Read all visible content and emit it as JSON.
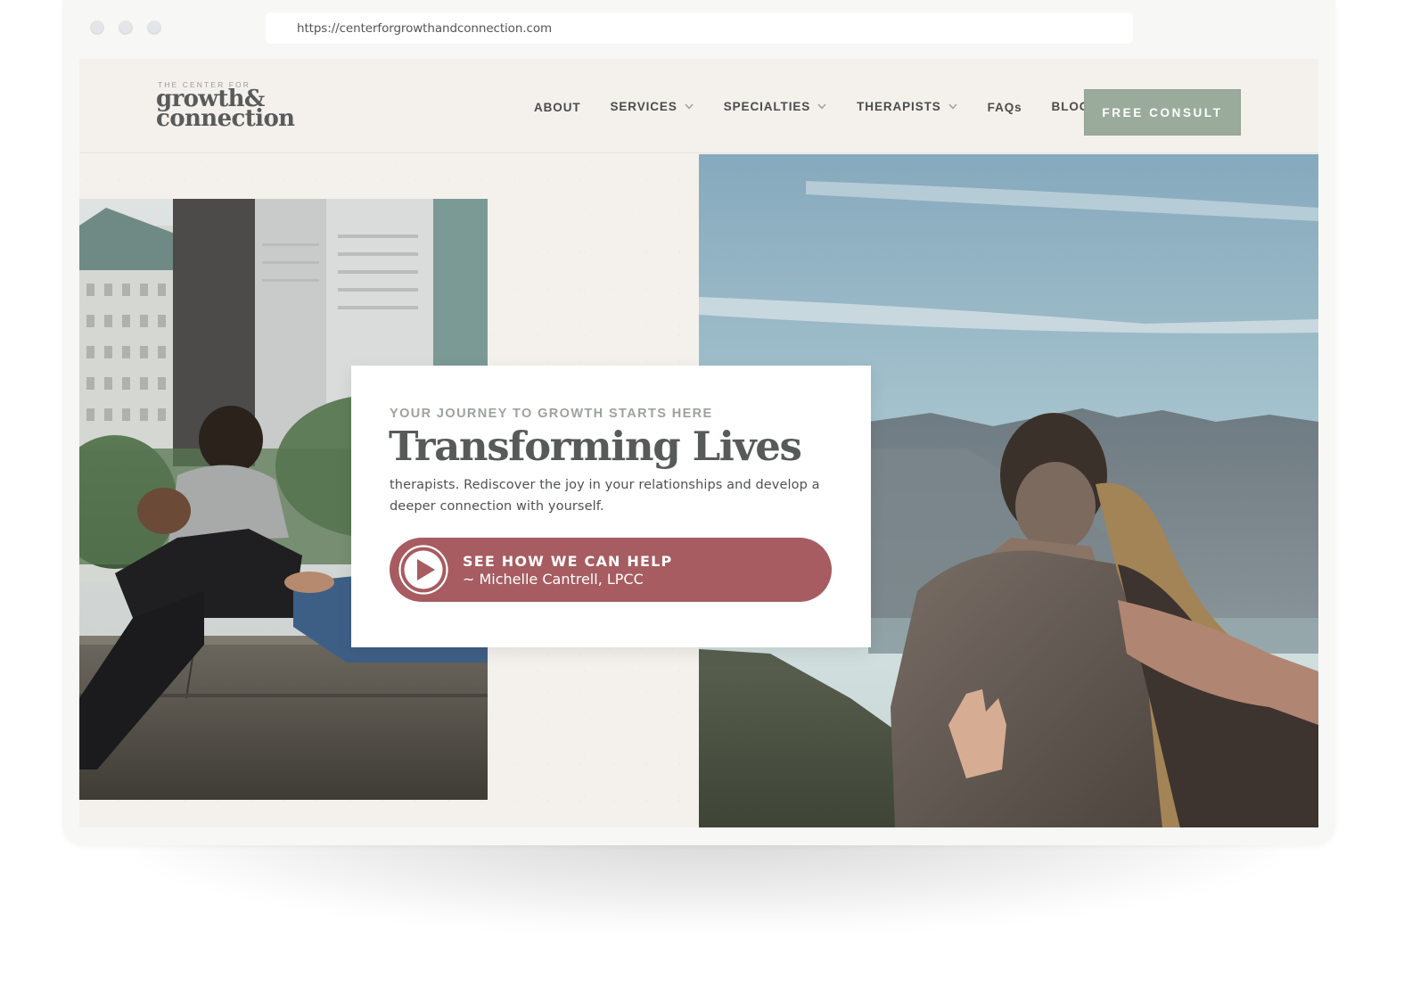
{
  "browser": {
    "url": "https://centerforgrowthandconnection.com"
  },
  "logo": {
    "tagline": "THE CENTER FOR",
    "line1": "growth&",
    "line2": "connection"
  },
  "nav": {
    "items": [
      {
        "label": "ABOUT",
        "has_dropdown": false
      },
      {
        "label": "SERVICES",
        "has_dropdown": true
      },
      {
        "label": "SPECIALTIES",
        "has_dropdown": true
      },
      {
        "label": "THERAPISTS",
        "has_dropdown": true
      },
      {
        "label": "FAQs",
        "has_dropdown": false
      },
      {
        "label": "BLOG",
        "has_dropdown": false
      }
    ],
    "cta_label": "FREE CONSULT"
  },
  "hero": {
    "eyebrow": "YOUR JOURNEY TO GROWTH STARTS HERE",
    "title": "Transforming Lives",
    "body": "therapists. Rediscover the joy in your relationships and develop a deeper connection with yourself.",
    "cta_title": "SEE HOW WE CAN HELP",
    "cta_subtitle": "~ Michelle Cantrell, LPCC"
  },
  "images": {
    "left": "couple-embracing-on-stone-wall-city-park-photo",
    "right": "couple-overlooking-mountains-photo"
  },
  "colors": {
    "accent_green": "#9aab9b",
    "cta_rose": "#a65c60",
    "background": "#f4f1ec",
    "text_dark": "#565a59"
  }
}
